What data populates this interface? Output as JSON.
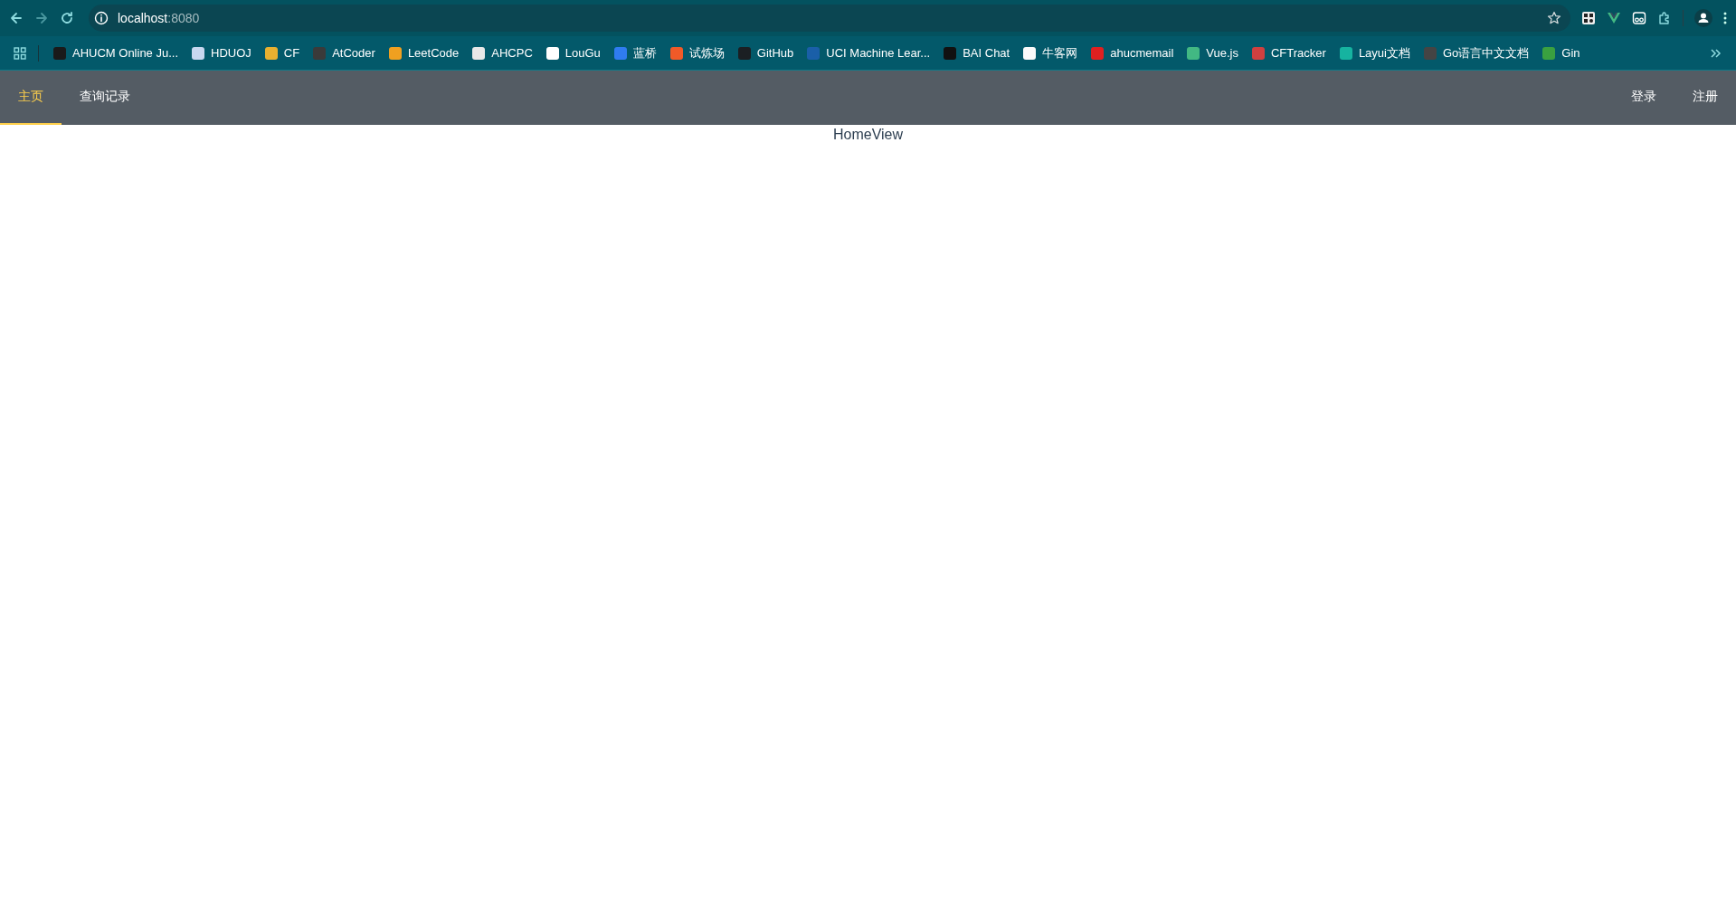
{
  "browser": {
    "address_host": "localhost",
    "address_port": ":8080",
    "bookmarks": [
      {
        "label": "AHUCM Online Ju...",
        "color": "#1a1a1a"
      },
      {
        "label": "HDUOJ",
        "color": "#c8d8f0"
      },
      {
        "label": "CF",
        "color": "#e8b030"
      },
      {
        "label": "AtCoder",
        "color": "#3a3a3a"
      },
      {
        "label": "LeetCode",
        "color": "#f0a020"
      },
      {
        "label": "AHCPC",
        "color": "#e8e8e8"
      },
      {
        "label": "LouGu",
        "color": "#ffffff"
      },
      {
        "label": "蓝桥",
        "color": "#2f7cf0"
      },
      {
        "label": "试炼场",
        "color": "#f05a28"
      },
      {
        "label": "GitHub",
        "color": "#1b1f23"
      },
      {
        "label": "UCI Machine Lear...",
        "color": "#1a5fa8"
      },
      {
        "label": "BAI Chat",
        "color": "#111111"
      },
      {
        "label": "牛客网",
        "color": "#fafafa"
      },
      {
        "label": "ahucmemail",
        "color": "#e02020"
      },
      {
        "label": "Vue.js",
        "color": "#42b883"
      },
      {
        "label": "CFTracker",
        "color": "#d04040"
      },
      {
        "label": "Layui文档",
        "color": "#16b3a0"
      },
      {
        "label": "Go语言中文文档",
        "color": "#444444"
      },
      {
        "label": "Gin",
        "color": "#3aa040"
      }
    ]
  },
  "nav": {
    "left": [
      {
        "label": "主页",
        "selected": true
      },
      {
        "label": "查询记录",
        "selected": false
      }
    ],
    "right": [
      {
        "label": "登录",
        "selected": false
      },
      {
        "label": "注册",
        "selected": false
      }
    ]
  },
  "content": {
    "text": "HomeView"
  }
}
